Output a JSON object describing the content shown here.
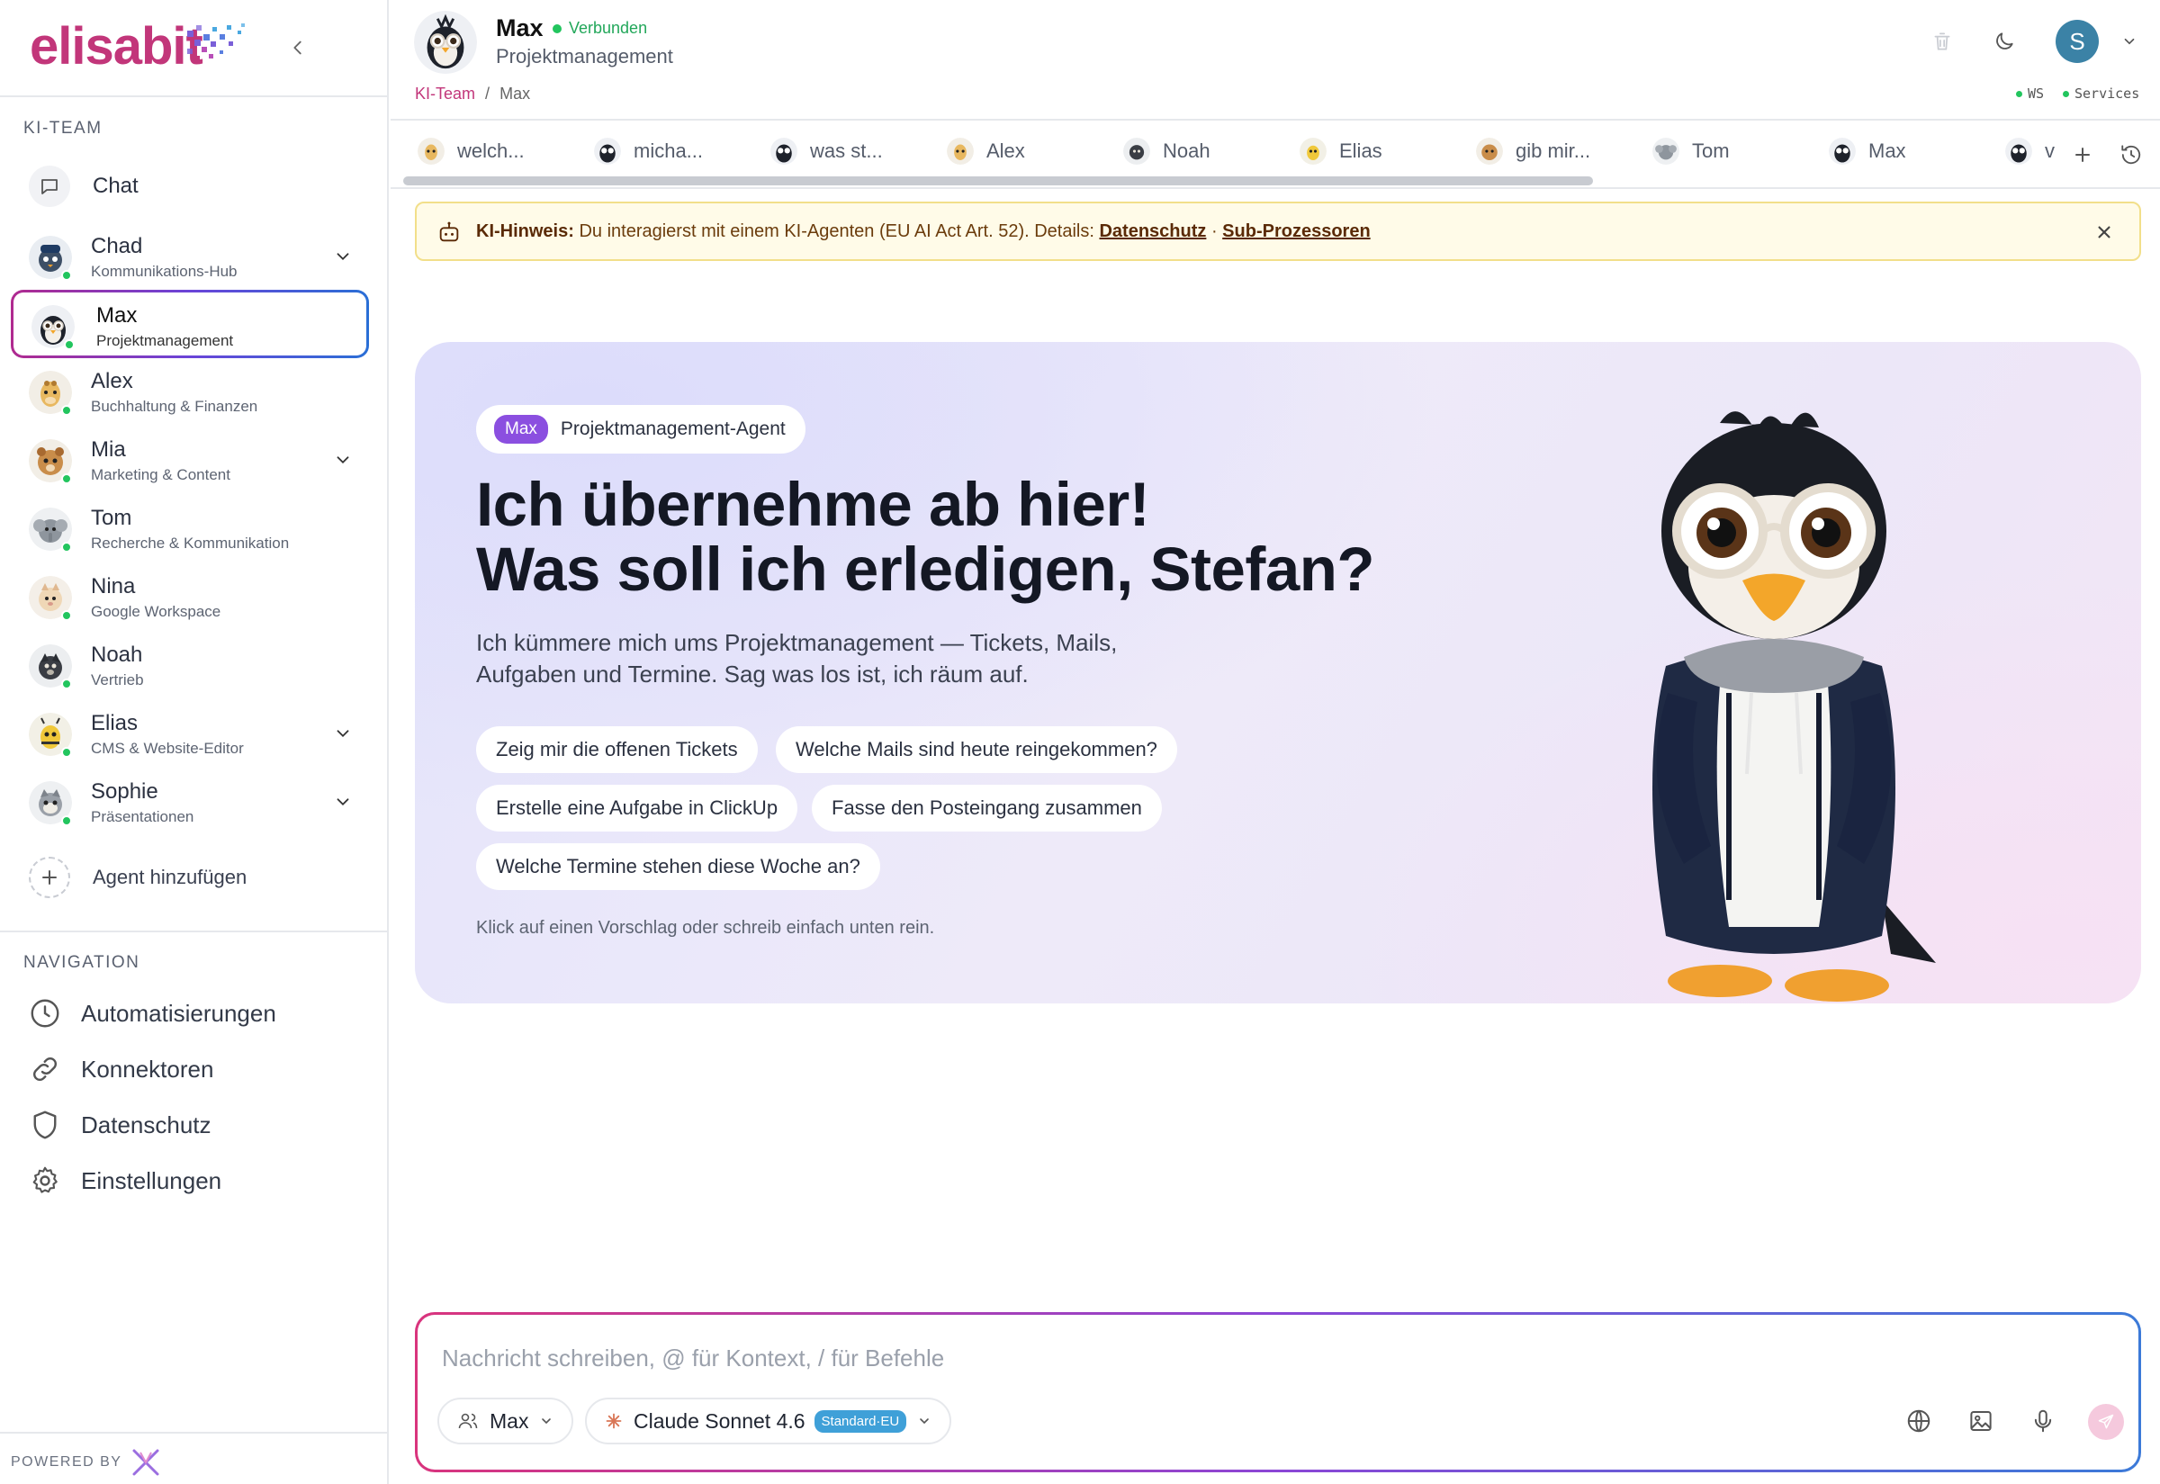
{
  "brand": {
    "name": "elisabit"
  },
  "sidebar": {
    "team_label": "KI-TEAM",
    "chat_label": "Chat",
    "agents": [
      {
        "name": "Chad",
        "role": "Kommunikations-Hub",
        "expandable": true
      },
      {
        "name": "Max",
        "role": "Projektmanagement",
        "active": true
      },
      {
        "name": "Alex",
        "role": "Buchhaltung & Finanzen"
      },
      {
        "name": "Mia",
        "role": "Marketing & Content",
        "expandable": true
      },
      {
        "name": "Tom",
        "role": "Recherche & Kommunikation"
      },
      {
        "name": "Nina",
        "role": "Google Workspace"
      },
      {
        "name": "Noah",
        "role": "Vertrieb"
      },
      {
        "name": "Elias",
        "role": "CMS & Website-Editor",
        "expandable": true
      },
      {
        "name": "Sophie",
        "role": "Präsentationen",
        "expandable": true
      }
    ],
    "add_agent_label": "Agent hinzufügen",
    "nav_label": "NAVIGATION",
    "nav_items": [
      {
        "label": "Automatisierungen",
        "icon": "clock-icon"
      },
      {
        "label": "Konnektoren",
        "icon": "link-icon"
      },
      {
        "label": "Datenschutz",
        "icon": "shield-icon"
      },
      {
        "label": "Einstellungen",
        "icon": "gear-icon"
      }
    ],
    "powered_by": "POWERED BY"
  },
  "header": {
    "agent_name": "Max",
    "status": "Verbunden",
    "role": "Projektmanagement",
    "breadcrumb": {
      "root": "KI-Team",
      "separator": "/",
      "current": "Max"
    },
    "user_initial": "S",
    "connections": [
      {
        "label": "WS"
      },
      {
        "label": "Services"
      }
    ]
  },
  "tabs": [
    {
      "label": "welch..."
    },
    {
      "label": "micha..."
    },
    {
      "label": "was st..."
    },
    {
      "label": "Alex"
    },
    {
      "label": "Noah"
    },
    {
      "label": "Elias"
    },
    {
      "label": "gib mir..."
    },
    {
      "label": "Tom"
    },
    {
      "label": "Max"
    },
    {
      "label": "v"
    }
  ],
  "notice": {
    "bold": "KI-Hinweis:",
    "text": " Du interagierst mit einem KI-Agenten (EU AI Act Art. 52). Details: ",
    "link1": "Datenschutz",
    "sep": " · ",
    "link2": "Sub-Prozessoren"
  },
  "hero": {
    "badge": "Max",
    "badge_text": "Projektmanagement-Agent",
    "title_line1": "Ich übernehme ab hier!",
    "title_line2": "Was soll ich erledigen, Stefan?",
    "description": "Ich kümmere mich ums Projektmanagement — Tickets, Mails, Aufgaben und Termine. Sag was los ist, ich räum auf.",
    "suggestions": [
      "Zeig mir die offenen Tickets",
      "Welche Mails sind heute reingekommen?",
      "Erstelle eine Aufgabe in ClickUp",
      "Fasse den Posteingang zusammen",
      "Welche Termine stehen diese Woche an?"
    ],
    "hint": "Klick auf einen Vorschlag oder schreib einfach unten rein."
  },
  "composer": {
    "placeholder": "Nachricht schreiben, @ für Kontext, / für Befehle",
    "agent_select": "Max",
    "model_select": "Claude Sonnet 4.6",
    "model_badge": "Standard·EU"
  },
  "colors": {
    "brand": "#c2367a",
    "accent_purple": "#8b4fe0",
    "online": "#22c55e",
    "notice_bg": "#fffbe8"
  }
}
